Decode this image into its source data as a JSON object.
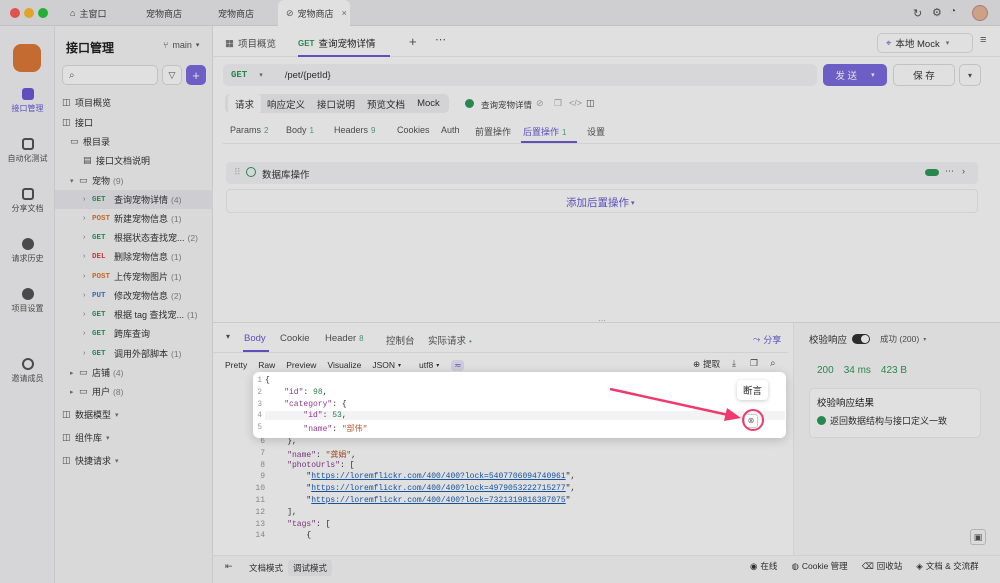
{
  "window": {
    "tabs": [
      {
        "label": "主窗口",
        "icon": "home-icon"
      },
      {
        "label": "宠物商店",
        "icon": ""
      },
      {
        "label": "宠物商店",
        "icon": ""
      },
      {
        "label": "宠物商店",
        "icon": "link-icon",
        "close": "×"
      }
    ]
  },
  "rail": {
    "items": [
      "接口管理",
      "自动化测试",
      "分享文档",
      "请求历史",
      "项目设置",
      "邀请成员"
    ]
  },
  "sidebar": {
    "title": "接口管理",
    "branch": "main",
    "add": "+",
    "tree": [
      {
        "label": "项目概览",
        "indent": 0,
        "method": "",
        "count": "",
        "kind": "link"
      },
      {
        "label": "接口",
        "indent": 0,
        "method": "",
        "count": "",
        "kind": "group",
        "arrow": "▾"
      },
      {
        "label": "根目录",
        "indent": 1,
        "method": "",
        "count": "",
        "kind": "folder"
      },
      {
        "label": "接口文档说明",
        "indent": 2,
        "method": "",
        "count": "",
        "kind": "doc"
      },
      {
        "label": "宠物",
        "indent": 1,
        "method": "",
        "count": "(9)",
        "kind": "folder",
        "arrow": "▾"
      },
      {
        "label": "查询宠物详情",
        "indent": 2,
        "method": "GET",
        "count": "(4)",
        "kind": "api",
        "selected": true
      },
      {
        "label": "新建宠物信息",
        "indent": 2,
        "method": "POST",
        "count": "(1)",
        "kind": "api"
      },
      {
        "label": "根据状态查找宠...",
        "indent": 2,
        "method": "GET",
        "count": "(2)",
        "kind": "api"
      },
      {
        "label": "删除宠物信息",
        "indent": 2,
        "method": "DEL",
        "count": "(1)",
        "kind": "api"
      },
      {
        "label": "上传宠物图片",
        "indent": 2,
        "method": "POST",
        "count": "(1)",
        "kind": "api"
      },
      {
        "label": "修改宠物信息",
        "indent": 2,
        "method": "PUT",
        "count": "(2)",
        "kind": "api"
      },
      {
        "label": "根据 tag 查找宠...",
        "indent": 2,
        "method": "GET",
        "count": "(1)",
        "kind": "api"
      },
      {
        "label": "跨库查询",
        "indent": 2,
        "method": "GET",
        "count": "",
        "kind": "api"
      },
      {
        "label": "调用外部脚本",
        "indent": 2,
        "method": "GET",
        "count": "(1)",
        "kind": "api"
      },
      {
        "label": "店铺",
        "indent": 1,
        "method": "",
        "count": "(4)",
        "kind": "folder",
        "arrow": "▸"
      },
      {
        "label": "用户",
        "indent": 1,
        "method": "",
        "count": "(8)",
        "kind": "folder",
        "arrow": "▸"
      },
      {
        "label": "数据模型",
        "indent": 0,
        "method": "",
        "count": "",
        "kind": "link",
        "arrow": "▾"
      },
      {
        "label": "组件库",
        "indent": 0,
        "method": "",
        "count": "",
        "kind": "link",
        "arrow": "▾"
      },
      {
        "label": "快捷请求",
        "indent": 0,
        "method": "",
        "count": "",
        "kind": "link",
        "arrow": "▾"
      }
    ]
  },
  "colors": {
    "GET": "#2d9a5a",
    "POST": "#e2772a",
    "DEL": "#e0483f",
    "PUT": "#3a7bd5",
    "accent": "#6b5bd6"
  },
  "main": {
    "tabs": [
      {
        "label": "项目概览",
        "method": ""
      },
      {
        "label": "查询宠物详情",
        "method": "GET"
      }
    ],
    "env": "本地 Mock",
    "request": {
      "method": "GET",
      "url": "/pet/{petId}",
      "send": "发 送",
      "save": "保 存"
    },
    "subtabs": [
      "请求",
      "响应定义",
      "接口说明",
      "预览文档",
      "Mock"
    ],
    "api_name": "查询宠物详情",
    "params_tabs": [
      {
        "label": "Params",
        "badge": "2"
      },
      {
        "label": "Body",
        "badge": "1"
      },
      {
        "label": "Headers",
        "badge": "9"
      },
      {
        "label": "Cookies",
        "badge": ""
      },
      {
        "label": "Auth",
        "badge": ""
      },
      {
        "label": "前置操作",
        "badge": ""
      },
      {
        "label": "后置操作",
        "badge": "1"
      },
      {
        "label": "设置",
        "badge": ""
      }
    ],
    "post_op": {
      "name": "数据库操作",
      "add": "添加后置操作"
    },
    "response": {
      "tabs": [
        {
          "label": "Body",
          "badge": ""
        },
        {
          "label": "Cookie",
          "badge": ""
        },
        {
          "label": "Header",
          "badge": "8"
        },
        {
          "label": "控制台",
          "badge": ""
        },
        {
          "label": "实际请求",
          "badge": "•"
        }
      ],
      "share": "分享",
      "formats": [
        "Pretty",
        "Raw",
        "Preview",
        "Visualize",
        "JSON",
        "utf8"
      ],
      "extract": "提取",
      "tooltip": "断言",
      "lines": [
        "{",
        "    \"id\": 98,",
        "    \"category\": {",
        "        \"id\": 53,",
        "        \"name\": \"部伟\"",
        "    },",
        "    \"name\": \"龚娟\",",
        "    \"photoUrls\": [",
        "        \"https://loremflickr.com/400/400?lock=5407706094740961\",",
        "        \"https://loremflickr.com/400/400?lock=4979053222715277\",",
        "        \"https://loremflickr.com/400/400?lock=7321319816387075\"",
        "    ],",
        "    \"tags\": [",
        "        {"
      ]
    },
    "validation": {
      "label": "校验响应",
      "status": "成功 (200)",
      "code": "200",
      "time": "34 ms",
      "size": "423 B",
      "result_title": "校验响应结果",
      "result_text": "返回数据结构与接口定义一致"
    }
  },
  "statusbar": {
    "left": [
      "文档模式",
      "调试模式"
    ],
    "right": [
      "在线",
      "Cookie 管理",
      "回收站",
      "文档 & 交流群"
    ]
  }
}
